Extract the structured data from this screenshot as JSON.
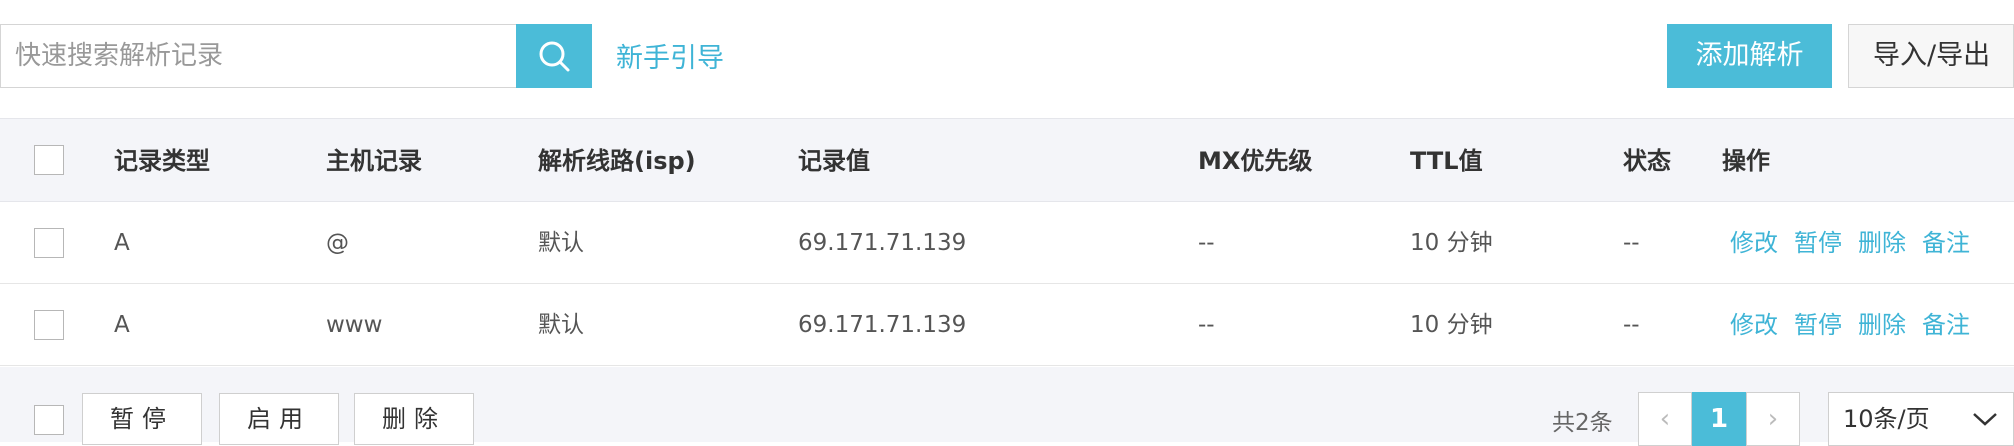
{
  "toolbar": {
    "search_placeholder": "快速搜索解析记录",
    "guide_link": "新手引导",
    "add_button": "添加解析",
    "import_export_button": "导入/导出"
  },
  "table": {
    "headers": [
      "记录类型",
      "主机记录",
      "解析线路(isp)",
      "记录值",
      "MX优先级",
      "TTL值",
      "状态",
      "操作"
    ],
    "rows": [
      {
        "type": "A",
        "host": "@",
        "line": "默认",
        "value": "69.171.71.139",
        "mx": "--",
        "ttl": "10 分钟",
        "status": "--"
      },
      {
        "type": "A",
        "host": "www",
        "line": "默认",
        "value": "69.171.71.139",
        "mx": "--",
        "ttl": "10 分钟",
        "status": "--"
      }
    ],
    "row_actions": [
      "修改",
      "暂停",
      "删除",
      "备注"
    ]
  },
  "footer": {
    "bulk_actions": [
      "暂停",
      "启用",
      "删除"
    ],
    "total": "共2条",
    "current_page": "1",
    "prev": "‹",
    "next": "›",
    "page_size": "10条/页"
  },
  "colors": {
    "accent": "#4bbcd8",
    "link": "#3fb4d6",
    "header_bg": "#f4f5f9"
  },
  "icons": {
    "search": "search-icon",
    "dropdown": "chevron-down-icon"
  }
}
